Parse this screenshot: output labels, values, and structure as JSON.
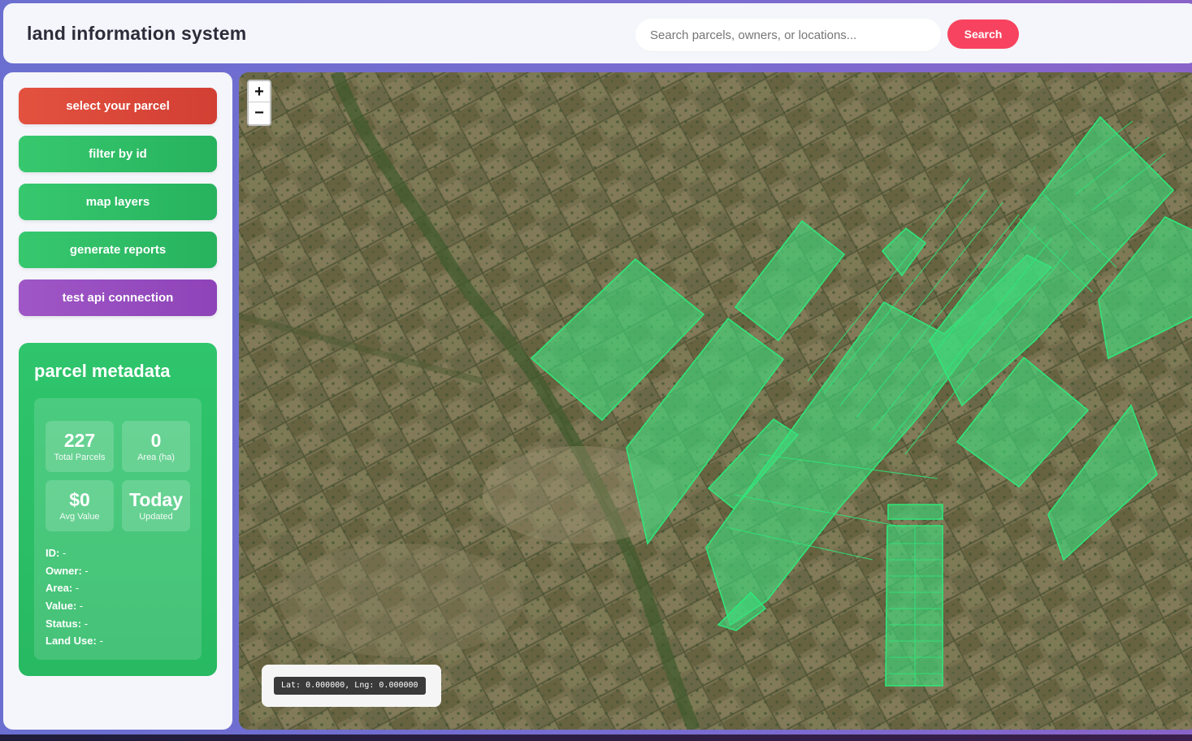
{
  "header": {
    "title": "land information system",
    "search_placeholder": "Search parcels, owners, or locations...",
    "search_button": "Search"
  },
  "sidebar": {
    "buttons": [
      {
        "label": "select your parcel",
        "color": "#d94538"
      },
      {
        "label": "filter by id",
        "color": "#2fbf67"
      },
      {
        "label": "map layers",
        "color": "#2fbf67"
      },
      {
        "label": "generate reports",
        "color": "#2fbf67"
      },
      {
        "label": "test api connection",
        "color": "#9750c0"
      }
    ],
    "metadata": {
      "title": "parcel metadata",
      "stats": [
        {
          "value": "227",
          "label": "Total Parcels"
        },
        {
          "value": "0",
          "label": "Area (ha)"
        },
        {
          "value": "$0",
          "label": "Avg Value"
        },
        {
          "value": "Today",
          "label": "Updated"
        }
      ],
      "fields": [
        {
          "label": "ID:",
          "value": "-"
        },
        {
          "label": "Owner:",
          "value": "-"
        },
        {
          "label": "Area:",
          "value": "-"
        },
        {
          "label": "Value:",
          "value": "-"
        },
        {
          "label": "Status:",
          "value": "-"
        },
        {
          "label": "Land Use:",
          "value": "-"
        }
      ]
    }
  },
  "map": {
    "zoom_in": "+",
    "zoom_out": "−",
    "coordinates": "Lat: 0.000000, Lng: 0.000000",
    "parcel_fill": "#3ddc7a",
    "parcel_stroke": "#2ee87a"
  }
}
